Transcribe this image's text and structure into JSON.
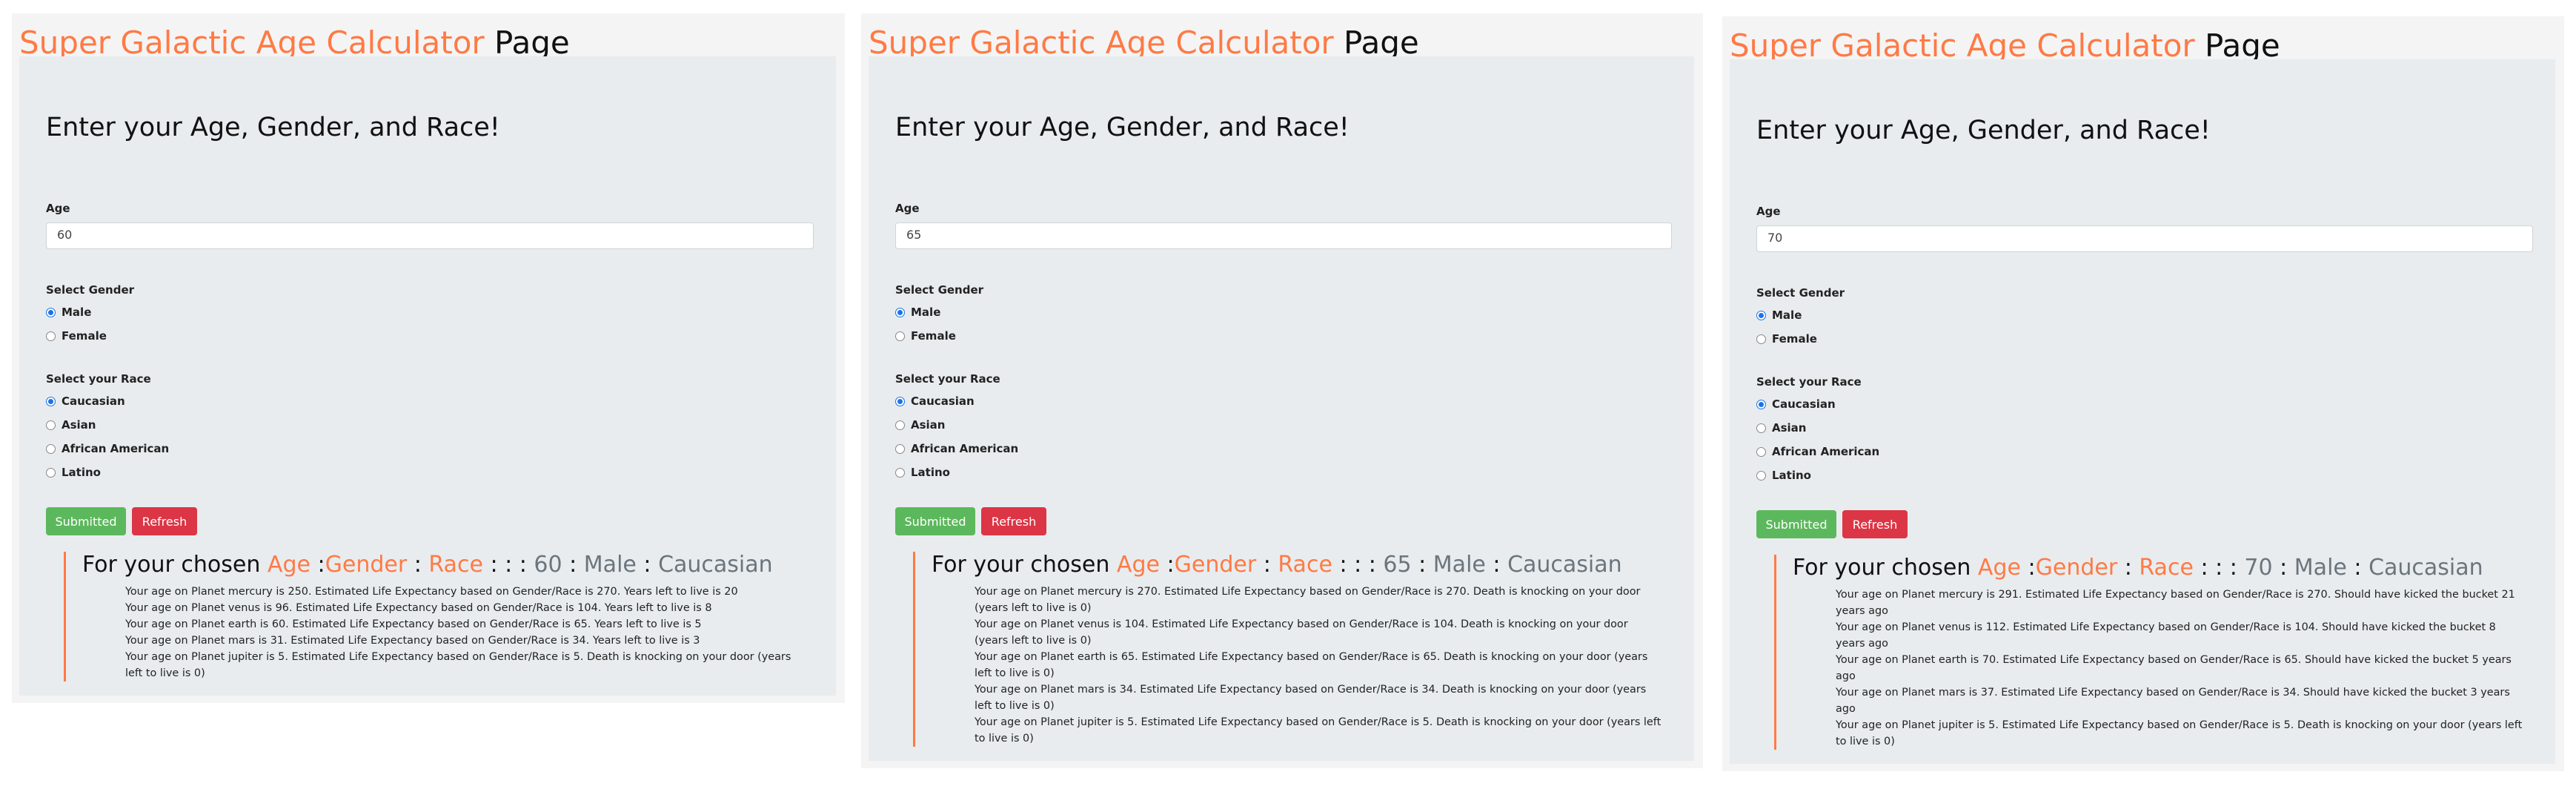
{
  "title": {
    "part1": "Super",
    "part2": "Galactic",
    "part3": "Age",
    "part4": "Calculator",
    "part5": "Page"
  },
  "form": {
    "heading": "Enter your Age, Gender, and Race!",
    "age_label": "Age",
    "gender_label": "Select Gender",
    "genders": [
      "Male",
      "Female"
    ],
    "race_label": "Select your Race",
    "races": [
      "Caucasian",
      "Asian",
      "African American",
      "Latino"
    ],
    "submit_label": "Submitted",
    "refresh_label": "Refresh"
  },
  "result_header": {
    "prefix": "For your chosen",
    "age": "Age",
    "colon1": ":",
    "gender": "Gender",
    "sep1": ":",
    "race": "Race",
    "sep2": ": : :"
  },
  "panels": [
    {
      "age": "60",
      "gender": "Male",
      "race": "Caucasian",
      "sep_a": ":",
      "sep_b": ":",
      "lines": [
        "Your age on Planet mercury is 250. Estimated Life Expectancy based on Gender/Race is 270. Years left to live is 20",
        "Your age on Planet venus is 96. Estimated Life Expectancy based on Gender/Race is 104. Years left to live is 8",
        "Your age on Planet earth is 60. Estimated Life Expectancy based on Gender/Race is 65. Years left to live is 5",
        "Your age on Planet mars is 31. Estimated Life Expectancy based on Gender/Race is 34. Years left to live is 3",
        "Your age on Planet jupiter is 5. Estimated Life Expectancy based on Gender/Race is 5. Death is knocking on your door (years left to live is 0)"
      ]
    },
    {
      "age": "65",
      "gender": "Male",
      "race": "Caucasian",
      "sep_a": ":",
      "sep_b": ":",
      "lines": [
        "Your age on Planet mercury is 270. Estimated Life Expectancy based on Gender/Race is 270. Death is knocking on your door (years left to live is 0)",
        "Your age on Planet venus is 104. Estimated Life Expectancy based on Gender/Race is 104. Death is knocking on your door (years left to live is 0)",
        "Your age on Planet earth is 65. Estimated Life Expectancy based on Gender/Race is 65. Death is knocking on your door (years left to live is 0)",
        "Your age on Planet mars is 34. Estimated Life Expectancy based on Gender/Race is 34. Death is knocking on your door (years left to live is 0)",
        "Your age on Planet jupiter is 5. Estimated Life Expectancy based on Gender/Race is 5. Death is knocking on your door (years left to live is 0)"
      ]
    },
    {
      "age": "70",
      "gender": "Male",
      "race": "Caucasian",
      "sep_a": ":",
      "sep_b": ":",
      "lines": [
        "Your age on Planet mercury is 291. Estimated Life Expectancy based on Gender/Race is 270. Should have kicked the bucket 21 years ago",
        "Your age on Planet venus is 112. Estimated Life Expectancy based on Gender/Race is 104. Should have kicked the bucket 8 years ago",
        "Your age on Planet earth is 70. Estimated Life Expectancy based on Gender/Race is 65. Should have kicked the bucket 5 years ago",
        "Your age on Planet mars is 37. Estimated Life Expectancy based on Gender/Race is 34. Should have kicked the bucket 3 years ago",
        "Your age on Planet jupiter is 5. Estimated Life Expectancy based on Gender/Race is 5. Death is knocking on your door (years left to live is 0)"
      ]
    }
  ]
}
